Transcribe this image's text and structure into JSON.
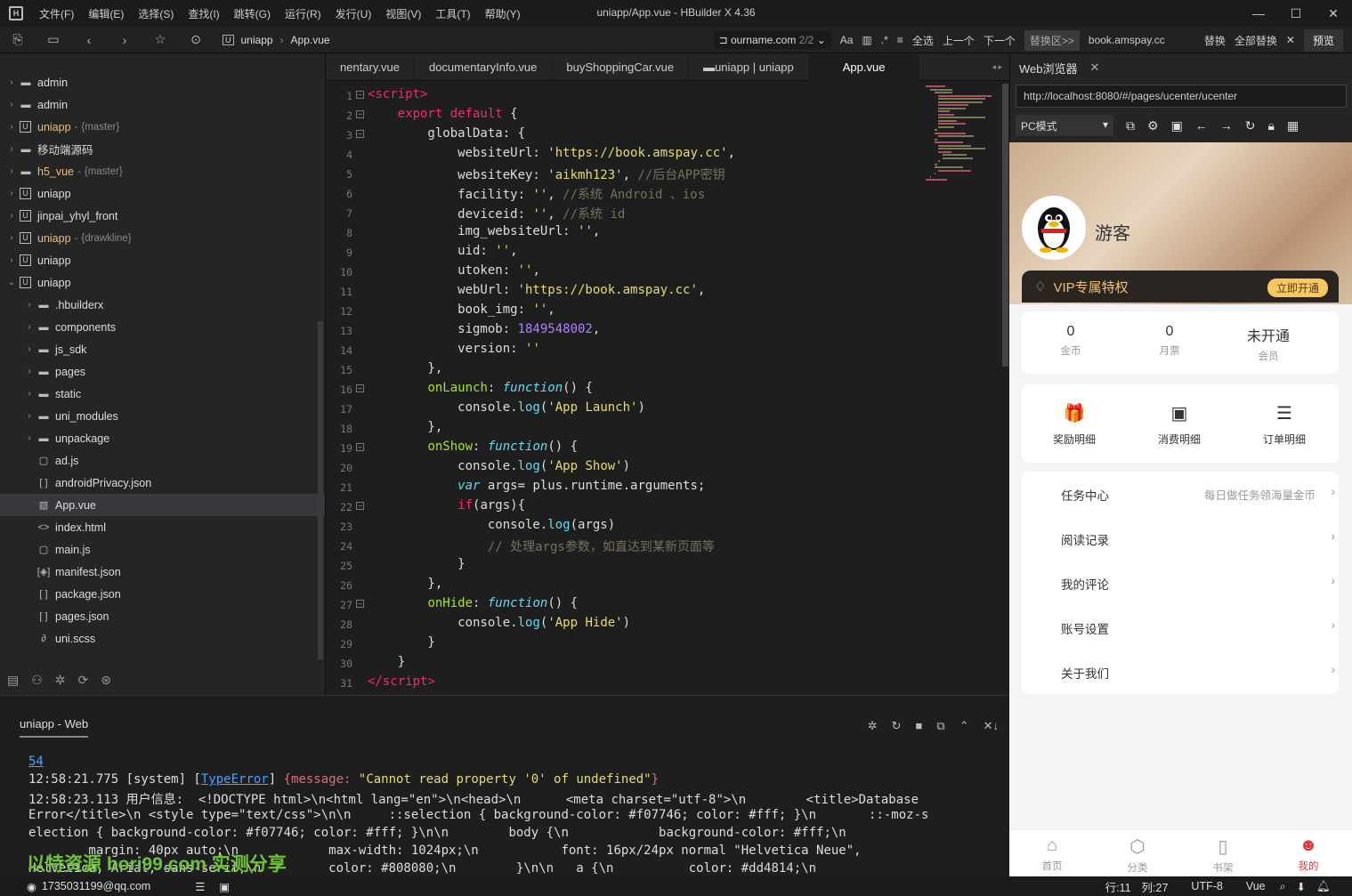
{
  "titlebar": {
    "title": "uniapp/App.vue - HBuilder X 4.36",
    "menus": [
      "文件(F)",
      "编辑(E)",
      "选择(S)",
      "查找(I)",
      "跳转(G)",
      "运行(R)",
      "发行(U)",
      "视图(V)",
      "工具(T)",
      "帮助(Y)"
    ]
  },
  "toolbar": {
    "breadcrumb": [
      "uniapp",
      "App.vue"
    ],
    "find_text": "ourname.com",
    "find_count": "2/2",
    "select_all": "全选",
    "prev": "上一个",
    "next": "下一个",
    "replace_area": "替换区>>",
    "replace_text": "book.amspay.cc",
    "replace": "替换",
    "replace_all": "全部替换",
    "preview": "预览"
  },
  "sidebar": {
    "items": [
      {
        "label": "admin",
        "branch": "",
        "indent": 0,
        "icon": "folder",
        "open": false,
        "sel": false
      },
      {
        "label": "admin",
        "branch": "",
        "indent": 0,
        "icon": "folder",
        "open": false,
        "sel": false
      },
      {
        "label": "uniapp",
        "branch": "{master}",
        "indent": 0,
        "icon": "project",
        "open": false,
        "sel": false,
        "yellow": true
      },
      {
        "label": "移动端源码",
        "branch": "",
        "indent": 0,
        "icon": "folder",
        "open": false,
        "sel": false
      },
      {
        "label": "h5_vue",
        "branch": "{master}",
        "indent": 0,
        "icon": "folder",
        "open": false,
        "sel": false,
        "yellow": true
      },
      {
        "label": "uniapp",
        "branch": "",
        "indent": 0,
        "icon": "project",
        "open": false,
        "sel": false
      },
      {
        "label": "jinpai_yhyl_front",
        "branch": "",
        "indent": 0,
        "icon": "project",
        "open": false,
        "sel": false
      },
      {
        "label": "uniapp",
        "branch": "{drawkline}",
        "indent": 0,
        "icon": "project",
        "open": false,
        "sel": false,
        "yellow": true
      },
      {
        "label": "uniapp",
        "branch": "",
        "indent": 0,
        "icon": "project",
        "open": false,
        "sel": false
      },
      {
        "label": "uniapp",
        "branch": "",
        "indent": 0,
        "icon": "project",
        "open": true,
        "sel": false
      },
      {
        "label": ".hbuilderx",
        "branch": "",
        "indent": 1,
        "icon": "folder",
        "open": false,
        "sel": false
      },
      {
        "label": "components",
        "branch": "",
        "indent": 1,
        "icon": "folder",
        "open": false,
        "sel": false
      },
      {
        "label": "js_sdk",
        "branch": "",
        "indent": 1,
        "icon": "folder",
        "open": false,
        "sel": false
      },
      {
        "label": "pages",
        "branch": "",
        "indent": 1,
        "icon": "folder",
        "open": false,
        "sel": false
      },
      {
        "label": "static",
        "branch": "",
        "indent": 1,
        "icon": "folder",
        "open": false,
        "sel": false
      },
      {
        "label": "uni_modules",
        "branch": "",
        "indent": 1,
        "icon": "folder",
        "open": false,
        "sel": false
      },
      {
        "label": "unpackage",
        "branch": "",
        "indent": 1,
        "icon": "folder",
        "open": false,
        "sel": false
      },
      {
        "label": "ad.js",
        "branch": "",
        "indent": 1,
        "icon": "file",
        "sel": false
      },
      {
        "label": "androidPrivacy.json",
        "branch": "",
        "indent": 1,
        "icon": "json",
        "sel": false
      },
      {
        "label": "App.vue",
        "branch": "",
        "indent": 1,
        "icon": "vue",
        "sel": true
      },
      {
        "label": "index.html",
        "branch": "",
        "indent": 1,
        "icon": "html",
        "sel": false
      },
      {
        "label": "main.js",
        "branch": "",
        "indent": 1,
        "icon": "file",
        "sel": false
      },
      {
        "label": "manifest.json",
        "branch": "",
        "indent": 1,
        "icon": "manifest",
        "sel": false
      },
      {
        "label": "package.json",
        "branch": "",
        "indent": 1,
        "icon": "json",
        "sel": false
      },
      {
        "label": "pages.json",
        "branch": "",
        "indent": 1,
        "icon": "json",
        "sel": false
      },
      {
        "label": "uni.scss",
        "branch": "",
        "indent": 1,
        "icon": "scss",
        "sel": false
      }
    ]
  },
  "tabs": [
    "nentary.vue",
    "documentaryInfo.vue",
    "buyShoppingCar.vue",
    "uniapp | uniapp",
    "App.vue"
  ],
  "code": [
    "<span class='k'>&lt;</span><span class='k'>script</span><span class='k'>&gt;</span>",
    "    <span class='k'>export default</span> {",
    "        globalData: {",
    "            websiteUrl: <span class='s'>'https://book.amspay.cc'</span>,",
    "            websiteKey: <span class='s'>'aikmh123'</span>, <span class='c'>//后台APP密钥</span>",
    "            facility: <span class='s'>''</span>, <span class='c'>//系统 Android 、ios</span>",
    "            deviceid: <span class='s'>''</span>, <span class='c'>//系统 id</span>",
    "            img_websiteUrl: <span class='s'>''</span>,",
    "            uid: <span class='s'>''</span>,",
    "            utoken: <span class='s'>''</span>,",
    "            webUrl: <span class='s'>'https://book.amspay.cc'</span>,",
    "            book_img: <span class='s'>''</span>,",
    "            sigmob: <span class='n'>1849548002</span>,",
    "            version: <span class='s'>''</span>",
    "        },",
    "        <span class='f'>onLaunch</span>: <span class='fn'>function</span>() {",
    "            console.<span class='m'>log</span>(<span class='s'>'App Launch'</span>)",
    "        },",
    "        <span class='f'>onShow</span>: <span class='fn'>function</span>() {",
    "            console.<span class='m'>log</span>(<span class='s'>'App Show'</span>)",
    "            <span class='fn'>var</span> args= plus.runtime.arguments;",
    "            <span class='k'>if</span>(args){",
    "                console.<span class='m'>log</span>(args)",
    "                <span class='c'>// 处理args参数，如直达到某新页面等</span>",
    "            }",
    "        },",
    "        <span class='f'>onHide</span>: <span class='fn'>function</span>() {",
    "            console.<span class='m'>log</span>(<span class='s'>'App Hide'</span>)",
    "        }",
    "    }",
    "<span class='k'>&lt;/</span><span class='k'>script</span><span class='k'>&gt;</span>"
  ],
  "browser": {
    "tab": "Web浏览器",
    "url": "http://localhost:8080/#/pages/ucenter/ucenter",
    "mode": "PC模式"
  },
  "app": {
    "username": "游客",
    "vip_label": "VIP专属特权",
    "vip_button": "立即开通",
    "stats": [
      {
        "value": "0",
        "label": "金币"
      },
      {
        "value": "0",
        "label": "月票"
      },
      {
        "value": "未开通",
        "label": "会员"
      }
    ],
    "entries": [
      {
        "icon": "🎁",
        "label": "奖励明细"
      },
      {
        "icon": "▣",
        "label": "消费明细"
      },
      {
        "icon": "☰",
        "label": "订单明细"
      }
    ],
    "menu": [
      {
        "label": "任务中心",
        "sub": "每日做任务领海量金币"
      },
      {
        "label": "阅读记录",
        "sub": ""
      },
      {
        "label": "我的评论",
        "sub": ""
      },
      {
        "label": "账号设置",
        "sub": ""
      },
      {
        "label": "关于我们",
        "sub": ""
      }
    ],
    "tabbar": [
      {
        "icon": "⌂",
        "label": "首页",
        "active": false
      },
      {
        "icon": "⬡",
        "label": "分类",
        "active": false
      },
      {
        "icon": "▯",
        "label": "书架",
        "active": false
      },
      {
        "icon": "☻",
        "label": "我的",
        "active": true
      }
    ]
  },
  "console": {
    "title": "uniapp - Web",
    "link": "54",
    "lines": [
      "12:58:21.775 [system] [<span style='color:#4aa3ff;text-decoration:underline'>TypeError</span>] <span style='color:#e06c75'>{message: </span><span class='s'>\"Cannot read property '0' of undefined\"</span><span style='color:#e06c75'>}</span>",
      "12:58:23.113 用户信息:  &lt;!DOCTYPE html&gt;\\n&lt;html lang=\"en\"&gt;\\n&lt;head&gt;\\n      &lt;meta charset=\"utf-8\"&gt;\\n        &lt;title&gt;Database",
      "Error&lt;/title&gt;\\n &lt;style type=\"text/css\"&gt;\\n\\n     ::selection { background-color: #f07746; color: #fff; }\\n       ::-moz-s",
      "election { background-color: #f07746; color: #fff; }\\n\\n        body {\\n            background-color: #fff;\\n",
      "        margin: 40px auto;\\n            max-width: 1024px;\\n           font: 16px/24px normal \"Helvetica Neue\",",
      "Helvetica, Arial, sans-serif;\\n         color: #808080;\\n        }\\n\\n   a {\\n          color: #dd4814;\\n"
    ]
  },
  "watermark": "以特资源 bori99.com 实测分享",
  "status": {
    "user": "1735031199@qq.com",
    "pos": "行:11",
    "col": "列:27",
    "enc": "UTF-8",
    "lang": "Vue"
  }
}
